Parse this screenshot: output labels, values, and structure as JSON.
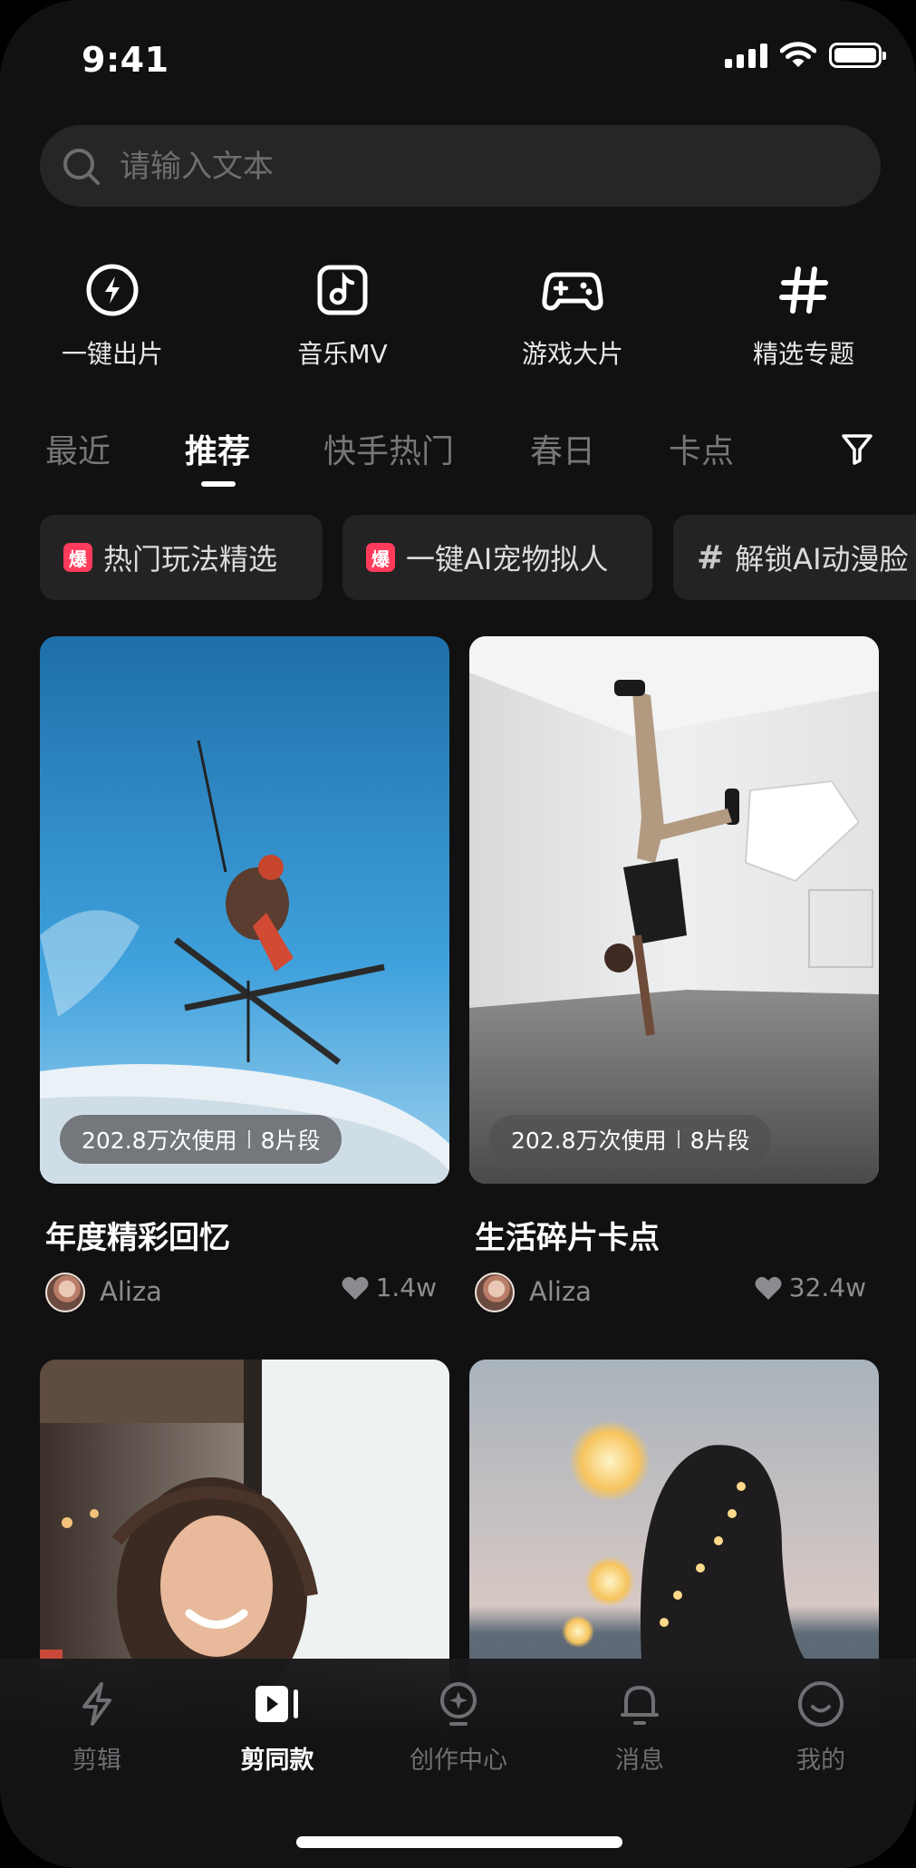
{
  "status_bar": {
    "time": "9:41",
    "battery_level": 1.0,
    "signal_bars": 4
  },
  "search": {
    "placeholder": "请输入文本",
    "value": ""
  },
  "quick_actions": [
    {
      "label": "一键出片",
      "icon": "lightning-circle-icon"
    },
    {
      "label": "音乐MV",
      "icon": "music-note-icon"
    },
    {
      "label": "游戏大片",
      "icon": "gamepad-icon"
    },
    {
      "label": "精选专题",
      "icon": "hashtag-icon"
    }
  ],
  "tabs": [
    {
      "label": "最近",
      "active": false
    },
    {
      "label": "推荐",
      "active": true
    },
    {
      "label": "快手热门",
      "active": false
    },
    {
      "label": "春日",
      "active": false
    },
    {
      "label": "卡点",
      "active": false
    }
  ],
  "chips": [
    {
      "badge": "爆",
      "label": "热门玩法精选"
    },
    {
      "badge": "爆",
      "label": "一键AI宠物拟人"
    },
    {
      "badge": "#",
      "label": "解锁AI动漫脸"
    }
  ],
  "cards": [
    {
      "usage": "202.8万次使用",
      "segments": "8片段",
      "title": "年度精彩回忆",
      "author": "Aliza",
      "likes": "1.4w",
      "image": "skier-jumping-photo"
    },
    {
      "usage": "202.8万次使用",
      "segments": "8片段",
      "title": "生活碎片卡点",
      "author": "Aliza",
      "likes": "32.4w",
      "image": "handstand-dancer-photo"
    },
    {
      "image": "smiling-woman-photo"
    },
    {
      "image": "woman-with-fairy-lights-photo"
    }
  ],
  "bottom_nav": [
    {
      "label": "剪辑",
      "icon": "lightning-icon",
      "active": false
    },
    {
      "label": "剪同款",
      "icon": "play-template-icon",
      "active": true
    },
    {
      "label": "创作中心",
      "icon": "bulb-star-icon",
      "active": false
    },
    {
      "label": "消息",
      "icon": "bell-icon",
      "active": false
    },
    {
      "label": "我的",
      "icon": "smiley-icon",
      "active": false
    }
  ],
  "colors": {
    "background": "#111112",
    "surface": "#232324",
    "badge": "#ff3b5c",
    "muted": "#77777a"
  }
}
